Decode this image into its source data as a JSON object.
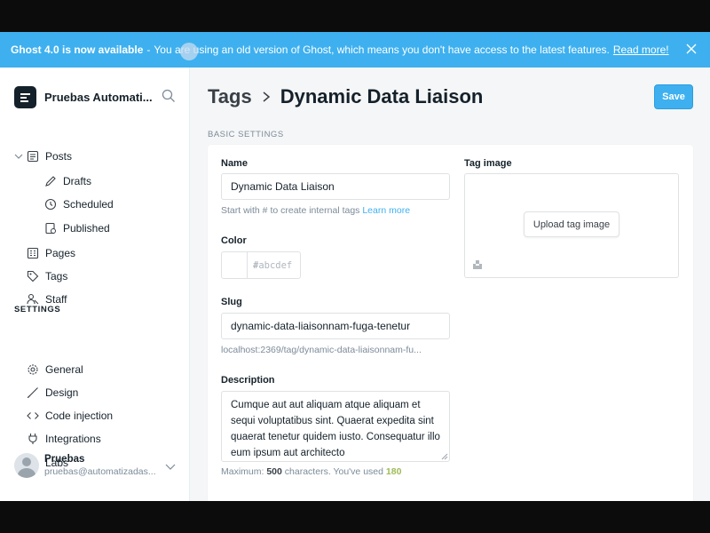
{
  "banner": {
    "strong": "Ghost 4.0 is now available",
    "separator": "-",
    "message": "You are using an old version of Ghost, which means you don't have access to the latest features.",
    "link": "Read more!"
  },
  "sidebar": {
    "site_name": "Pruebas Automati...",
    "posts": "Posts",
    "drafts": "Drafts",
    "scheduled": "Scheduled",
    "published": "Published",
    "pages": "Pages",
    "tags": "Tags",
    "staff": "Staff",
    "settings_label": "SETTINGS",
    "general": "General",
    "design": "Design",
    "code_injection": "Code injection",
    "integrations": "Integrations",
    "labs": "Labs",
    "user_name": "Pruebas",
    "user_email": "pruebas@automatizadas..."
  },
  "header": {
    "breadcrumb": "Tags",
    "title": "Dynamic Data Liaison",
    "save": "Save"
  },
  "form": {
    "section_label": "BASIC SETTINGS",
    "name_label": "Name",
    "name_value": "Dynamic Data Liaison",
    "name_hint": "Start with # to create internal tags",
    "learn_more": "Learn more",
    "color_label": "Color",
    "color_hash": "#",
    "color_placeholder": "abcdef",
    "slug_label": "Slug",
    "slug_value": "dynamic-data-liaisonnam-fuga-tenetur",
    "slug_url": "localhost:2369/tag/dynamic-data-liaisonnam-fu...",
    "description_label": "Description",
    "description_value": "Cumque aut aut aliquam atque aliquam et sequi voluptatibus sint. Quaerat expedita sint quaerat tenetur quidem iusto. Consequatur illo eum ipsum aut architecto",
    "count_prefix": "Maximum:",
    "count_max": "500",
    "count_middle": "characters. You've used",
    "count_used": "180",
    "tag_image_label": "Tag image",
    "upload_button": "Upload tag image"
  },
  "colors": {
    "accent": "#3eb0ef",
    "text": "#15212a",
    "muted": "#7c8b9a",
    "used_count": "#9fbb58"
  }
}
